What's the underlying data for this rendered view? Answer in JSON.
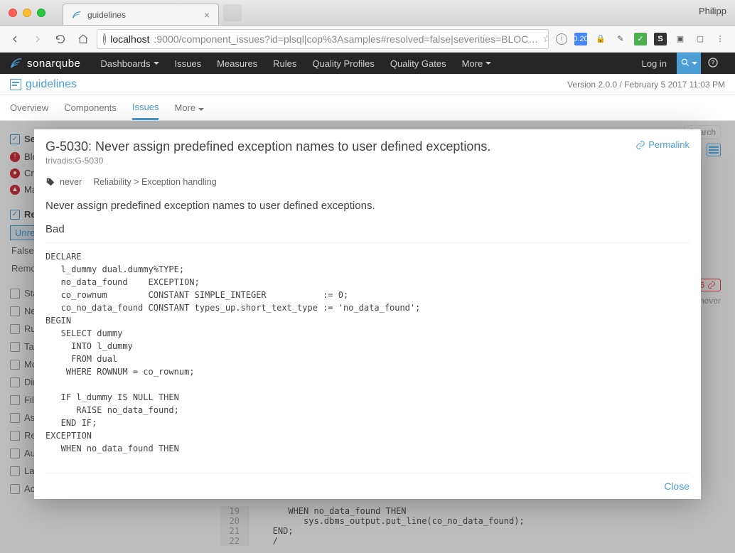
{
  "window": {
    "tab_title": "guidelines",
    "user": "Philipp"
  },
  "address": {
    "host": "localhost",
    "port_path": ":9000/component_issues?id=plsql|cop%3Asamples#resolved=false|severities=BLOC…",
    "info_icon": "info-icon"
  },
  "ext_badges": {
    "dl": "0.20",
    "s": "S"
  },
  "sq": {
    "logo": "sonarqube",
    "nav": [
      "Dashboards",
      "Issues",
      "Measures",
      "Rules",
      "Quality Profiles",
      "Quality Gates",
      "More"
    ],
    "login": "Log in"
  },
  "project": {
    "title": "guidelines",
    "meta": "Version 2.0.0 / February 5 2017 11:03 PM"
  },
  "subnav": [
    "Overview",
    "Components",
    "Issues",
    "More"
  ],
  "facets": {
    "severity": "Severity",
    "sev_items": [
      "Blocker",
      "Critical",
      "Major"
    ],
    "resolution": "Resolution",
    "unresolved": "Unresolved",
    "false_positive": "False Positive",
    "removed": "Removed",
    "others": [
      "Status",
      "New Issues",
      "Rule",
      "Tag",
      "Module",
      "Directory",
      "File",
      "Assignee",
      "Reporter",
      "Author",
      "Language",
      "Action Plan"
    ]
  },
  "bg_code": {
    "lines": [
      {
        "n": "19",
        "t": "      WHEN no_data_found THEN"
      },
      {
        "n": "20",
        "t": "         sys.dbms_output.put_line(co_no_data_found);"
      },
      {
        "n": "21",
        "t": "   END;"
      },
      {
        "n": "22",
        "t": "   /"
      }
    ]
  },
  "right_bits": {
    "search": "Search",
    "count": "6",
    "tag": "never"
  },
  "modal": {
    "title": "G-5030: Never assign predefined exception names to user defined exceptions.",
    "rule_key": "trivadis:G-5030",
    "permalink": "Permalink",
    "tags": "never",
    "breadcrumb": "Reliability > Exception handling",
    "description": "Never assign predefined exception names to user defined exceptions.",
    "section": "Bad",
    "code": "DECLARE\n   l_dummy dual.dummy%TYPE;\n   no_data_found    EXCEPTION;\n   co_rownum        CONSTANT SIMPLE_INTEGER           := 0;\n   co_no_data_found CONSTANT types_up.short_text_type := 'no_data_found';\nBEGIN\n   SELECT dummy\n     INTO l_dummy\n     FROM dual\n    WHERE ROWNUM = co_rownum;\n\n   IF l_dummy IS NULL THEN\n      RAISE no_data_found;\n   END IF;\nEXCEPTION\n   WHEN no_data_found THEN",
    "close": "Close"
  }
}
